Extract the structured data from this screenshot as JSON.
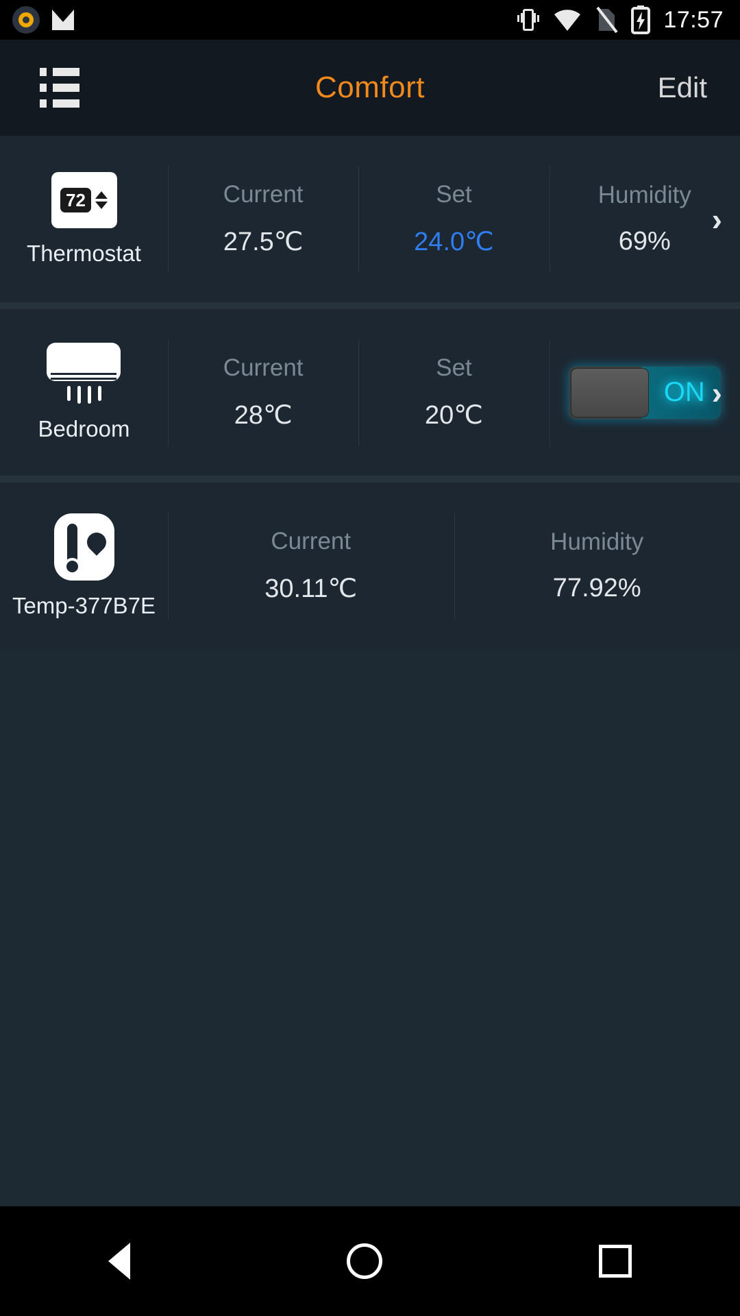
{
  "status_bar": {
    "time": "17:57",
    "icons": [
      "app-ring-icon",
      "gmail-icon",
      "vibrate-icon",
      "wifi-icon",
      "no-sim-icon",
      "battery-charging-icon"
    ]
  },
  "app_bar": {
    "menu_icon": "list-menu-icon",
    "title": "Comfort",
    "edit_label": "Edit"
  },
  "rows": [
    {
      "icon": "thermostat-icon",
      "icon_value": "72",
      "name": "Thermostat",
      "metrics": [
        {
          "label": "Current",
          "value": "27.5℃",
          "accent": false
        },
        {
          "label": "Set",
          "value": "24.0℃",
          "accent": true
        },
        {
          "label": "Humidity",
          "value": "69%",
          "accent": false
        }
      ],
      "has_toggle": false,
      "has_chevron": true
    },
    {
      "icon": "air-conditioner-icon",
      "name": "Bedroom",
      "metrics": [
        {
          "label": "Current",
          "value": "28℃",
          "accent": false
        },
        {
          "label": "Set",
          "value": "20℃",
          "accent": false
        }
      ],
      "has_toggle": true,
      "toggle_state": "ON",
      "has_chevron": true
    },
    {
      "icon": "temperature-humidity-sensor-icon",
      "name": "Temp-377B7E",
      "metrics": [
        {
          "label": "Current",
          "value": "30.11℃",
          "accent": false
        },
        {
          "label": "Humidity",
          "value": "77.92%",
          "accent": false
        }
      ],
      "has_toggle": false,
      "has_chevron": false
    }
  ],
  "nav_bar": {
    "back": "back-triangle-icon",
    "home": "home-circle-icon",
    "recents": "recents-square-icon"
  },
  "colors": {
    "accent_orange": "#f08a1e",
    "accent_blue": "#2f7df0",
    "accent_cyan": "#19d7f5",
    "background": "#1e2a33",
    "row_background": "#1c2731"
  }
}
